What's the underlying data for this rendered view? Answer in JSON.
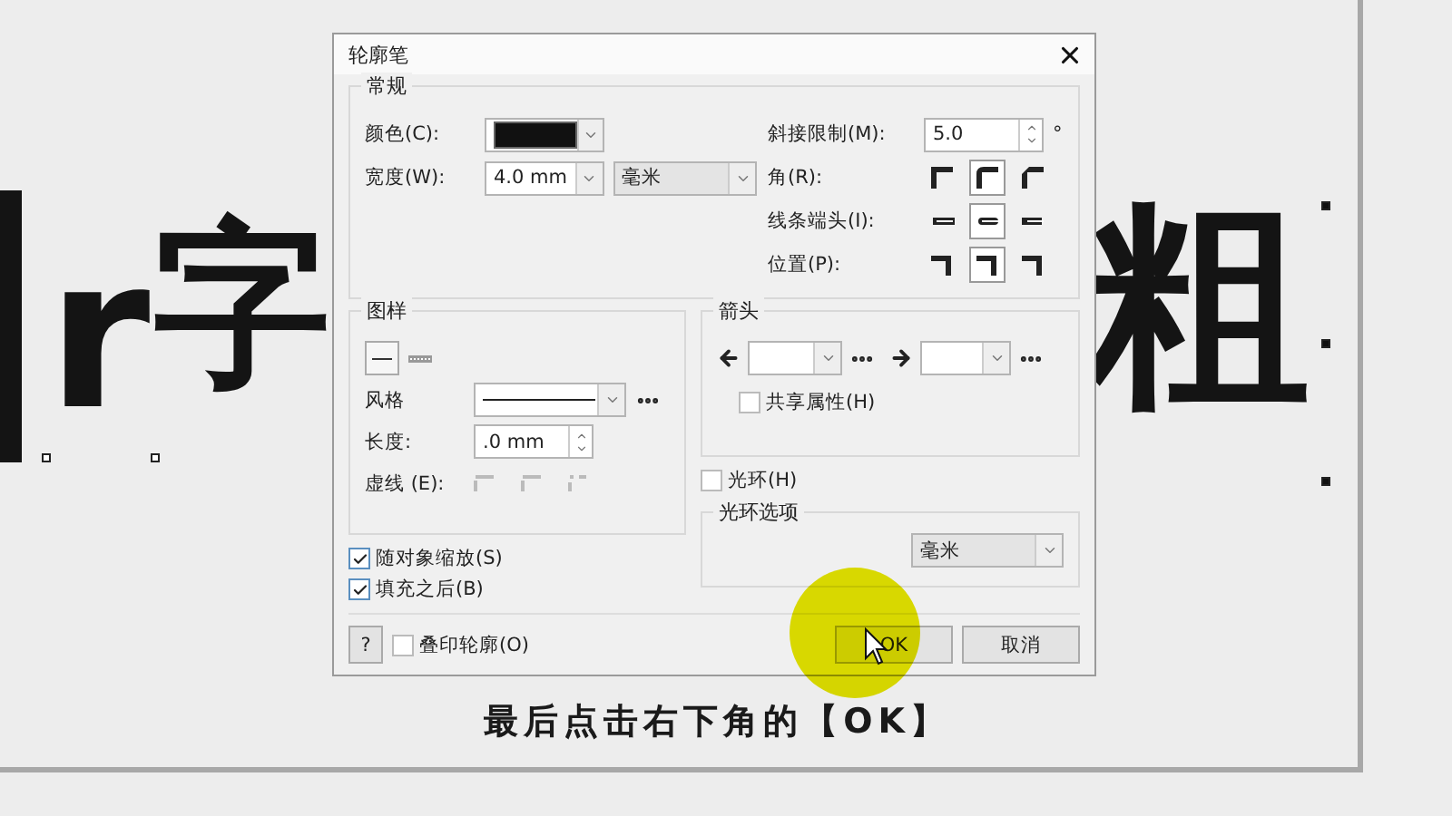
{
  "canvas": {
    "texts": [
      "r",
      "字",
      "粗"
    ]
  },
  "dialog": {
    "title": "轮廓笔",
    "general": {
      "legend": "常规",
      "color": {
        "label": "颜色(C):"
      },
      "width": {
        "label": "宽度(W):",
        "value": "4.0 mm",
        "unit": "毫米"
      },
      "miter": {
        "label": "斜接限制(M):",
        "value": "5.0",
        "suffix": "°"
      },
      "option_rows": [
        {
          "label": "角(R):",
          "kind": "corner",
          "options": [
            {
              "selected": false
            },
            {
              "selected": true
            },
            {
              "selected": false
            }
          ]
        },
        {
          "label": "线条端头(I):",
          "kind": "cap",
          "options": [
            {
              "selected": false
            },
            {
              "selected": true
            },
            {
              "selected": false
            }
          ]
        },
        {
          "label": "位置(P):",
          "kind": "position",
          "options": [
            {
              "selected": false
            },
            {
              "selected": true
            },
            {
              "selected": false
            }
          ]
        }
      ]
    },
    "pattern": {
      "legend": "图样",
      "style_label": "风格",
      "length_label": "长度:",
      "length_value": ".0 mm",
      "dash_label": "虚线 (E):"
    },
    "arrows": {
      "legend": "箭头",
      "share": {
        "label": "共享属性(H)",
        "checked": false
      }
    },
    "halo": {
      "label": "光环(H)",
      "checked": false
    },
    "halo_options": {
      "legend": "光环选项",
      "unit": "毫米"
    },
    "checks": [
      {
        "label": "随对象缩放(S)",
        "checked": true
      },
      {
        "label": "填充之后(B)",
        "checked": true
      }
    ],
    "help": "?",
    "overprint": {
      "label": "叠印轮廓(O)",
      "checked": false
    },
    "buttons": [
      "OK",
      "取消"
    ]
  },
  "caption": "最后点击右下角的【OK】"
}
